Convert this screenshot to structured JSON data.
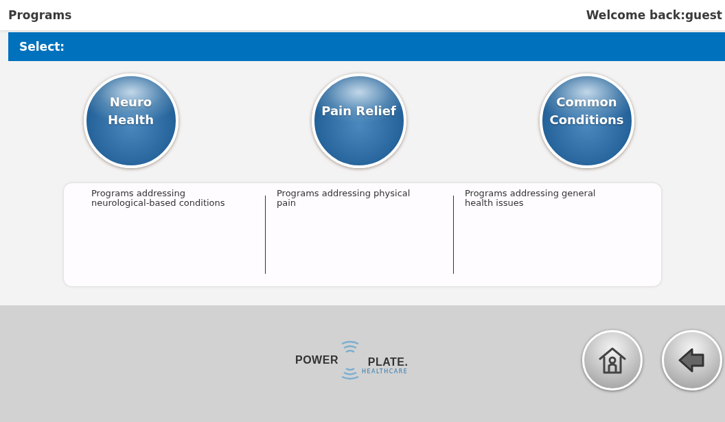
{
  "header": {
    "title": "Programs",
    "welcome": "Welcome back:guest"
  },
  "select_bar": {
    "label": "Select:"
  },
  "programs": [
    {
      "label_lines": [
        "Neuro",
        "Health"
      ],
      "description": "Programs addressing neurological-based conditions"
    },
    {
      "label_lines": [
        "Pain Relief"
      ],
      "description": "Programs addressing physical pain"
    },
    {
      "label_lines": [
        "Common",
        "Conditions"
      ],
      "description": "Programs addressing general health issues"
    }
  ],
  "footer": {
    "logo": {
      "left": "POWER",
      "right": "PLATE.",
      "sub": "HEALTHCARE"
    }
  }
}
